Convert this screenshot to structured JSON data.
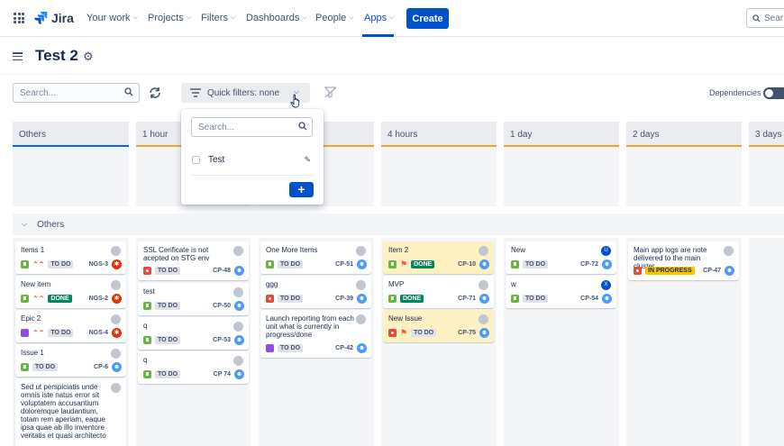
{
  "nav": {
    "product": "Jira",
    "items": [
      {
        "label": "Your work",
        "chevron": true
      },
      {
        "label": "Projects",
        "chevron": true
      },
      {
        "label": "Filters",
        "chevron": true
      },
      {
        "label": "Dashboards",
        "chevron": true
      },
      {
        "label": "People",
        "chevron": true
      },
      {
        "label": "Apps",
        "chevron": true,
        "active": true
      }
    ],
    "create_label": "Create",
    "search_placeholder": "Sear"
  },
  "board": {
    "title": "Test 2",
    "search_placeholder": "Search...",
    "quick_filters_label": "Quick filters: none",
    "dependencies_label": "Dependencies"
  },
  "quick_filter_dropdown": {
    "search_placeholder": "Search...",
    "items": [
      "Test"
    ],
    "add_label": "+"
  },
  "columns": [
    "Others",
    "1 hour",
    "",
    "4 hours",
    "1 day",
    "2 days",
    "3 days"
  ],
  "swimlane": {
    "label": "Others"
  },
  "cards": [
    {
      "summary": "Items 1",
      "type": "story",
      "priority": "high",
      "status": "TO DO",
      "key": "NGS-3"
    },
    {
      "summary": "New item",
      "type": "story",
      "priority": "high",
      "status": "DONE",
      "key": "NGS-2"
    },
    {
      "summary": "Epic 2",
      "type": "epic",
      "priority": "high",
      "status": "TO DO",
      "key": "NGS-4"
    },
    {
      "summary": "Issue 1",
      "type": "story",
      "status": "TO DO",
      "key": "CP-6"
    },
    {
      "summary": "Sed ut perspiciatis unde omnis iste natus error sit voluptatem accusantium doloremque laudantium, totam rem aperiam, eaque ipsa quae ab illo inventore veritatis et quasi architecto"
    },
    {
      "summary": "SSL Cerificate is not acepted on STG env",
      "type": "bug",
      "status": "TO DO",
      "key": "CP-48"
    },
    {
      "summary": "test",
      "type": "story",
      "status": "TO DO",
      "key": "CP-50"
    },
    {
      "summary": "q",
      "type": "story",
      "status": "TO DO",
      "key": "CP-53"
    },
    {
      "summary": "q",
      "type": "story",
      "status": "TO DO",
      "key": "CP 74"
    },
    {
      "summary": "One More Items",
      "type": "story",
      "status": "TO DO",
      "key": "CP-51"
    },
    {
      "summary": "ggg",
      "type": "bug",
      "status": "TO DO",
      "key": "CP-39"
    },
    {
      "summary": "Launch reporting from each unit what is currently in progress/done",
      "type": "epic",
      "status": "TO DO",
      "key": "CP-42"
    },
    {
      "summary": "Item 2",
      "type": "story",
      "flagged": true,
      "status": "DONE",
      "key": "CP-10"
    },
    {
      "summary": "MVP",
      "type": "story",
      "status": "DONE",
      "key": "CP-71"
    },
    {
      "summary": "New Issue",
      "type": "bug",
      "flagged": true,
      "status": "TO DO",
      "key": "CP-75"
    },
    {
      "summary": "New",
      "type": "story",
      "status": "TO DO",
      "key": "CP-72",
      "avatar": "U"
    },
    {
      "summary": "w",
      "type": "story",
      "status": "TO DO",
      "key": "CP-54",
      "avatar": "X"
    },
    {
      "summary": "Main app logs are note delivered to the main cluster",
      "type": "bug",
      "status": "IN PROGRESS",
      "key": "CP-47"
    }
  ],
  "colors": {
    "accent": "#0052cc",
    "done": "#00875a",
    "in_progress": "#ffc400",
    "flagged_card": "#fdf1c3"
  }
}
